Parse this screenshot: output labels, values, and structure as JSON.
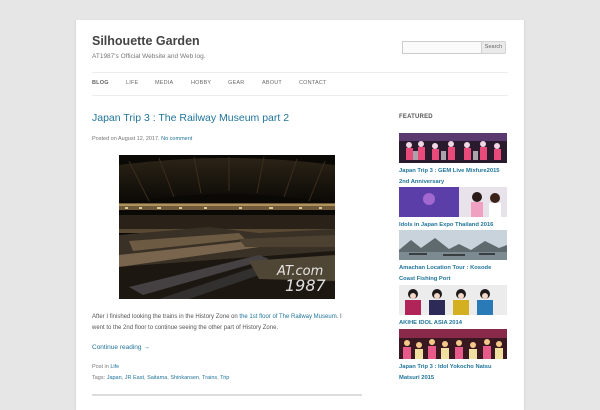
{
  "site": {
    "title": "Silhouette Garden",
    "description": "AT1987's Official Website and Web log."
  },
  "search": {
    "placeholder": "",
    "button_label": "Search"
  },
  "nav": {
    "items": [
      {
        "label": "BLOG",
        "active": true
      },
      {
        "label": "LIFE"
      },
      {
        "label": "MEDIA"
      },
      {
        "label": "HOBBY"
      },
      {
        "label": "GEAR"
      },
      {
        "label": "ABOUT"
      },
      {
        "label": "CONTACT"
      }
    ]
  },
  "post": {
    "title": "Japan Trip 3 : The Railway Museum part 2",
    "meta_prefix": "Posted on August 12, 2017.",
    "meta_link": "No comment",
    "image_watermark_top": "AT.com",
    "image_watermark_bottom": "1987",
    "excerpt_before": "After I finished looking the trains in the History Zone on ",
    "excerpt_link": "the 1st floor of The Railway Museum",
    "excerpt_after": ". I went to the 2nd floor to continue seeing the other part of History Zone.",
    "continue_label": "Continue reading →",
    "category_prefix": "Post in",
    "category": "Life",
    "tags_prefix": "Tags:",
    "tags": [
      "Japan",
      "JR East",
      "Saitama",
      "Shinkansen",
      "Trains",
      "Trip"
    ]
  },
  "sidebar": {
    "featured_heading": "FEATURED",
    "items": [
      {
        "title": "Japan Trip 3 : GEM Live Mixfure2015 2nd Anniversary"
      },
      {
        "title": "Idols in Japan Expo Thailand 2016"
      },
      {
        "title": "Amachan Location Tour : Kosode Coast Fishing Port"
      },
      {
        "title": "AKIHE IDOL ASIA 2014"
      },
      {
        "title": "Japan Trip 3 : Idol Yokocho Natsu Matsuri 2015"
      }
    ]
  },
  "colors": {
    "link": "#21759b",
    "background": "#e6e6e6",
    "page": "#ffffff"
  }
}
